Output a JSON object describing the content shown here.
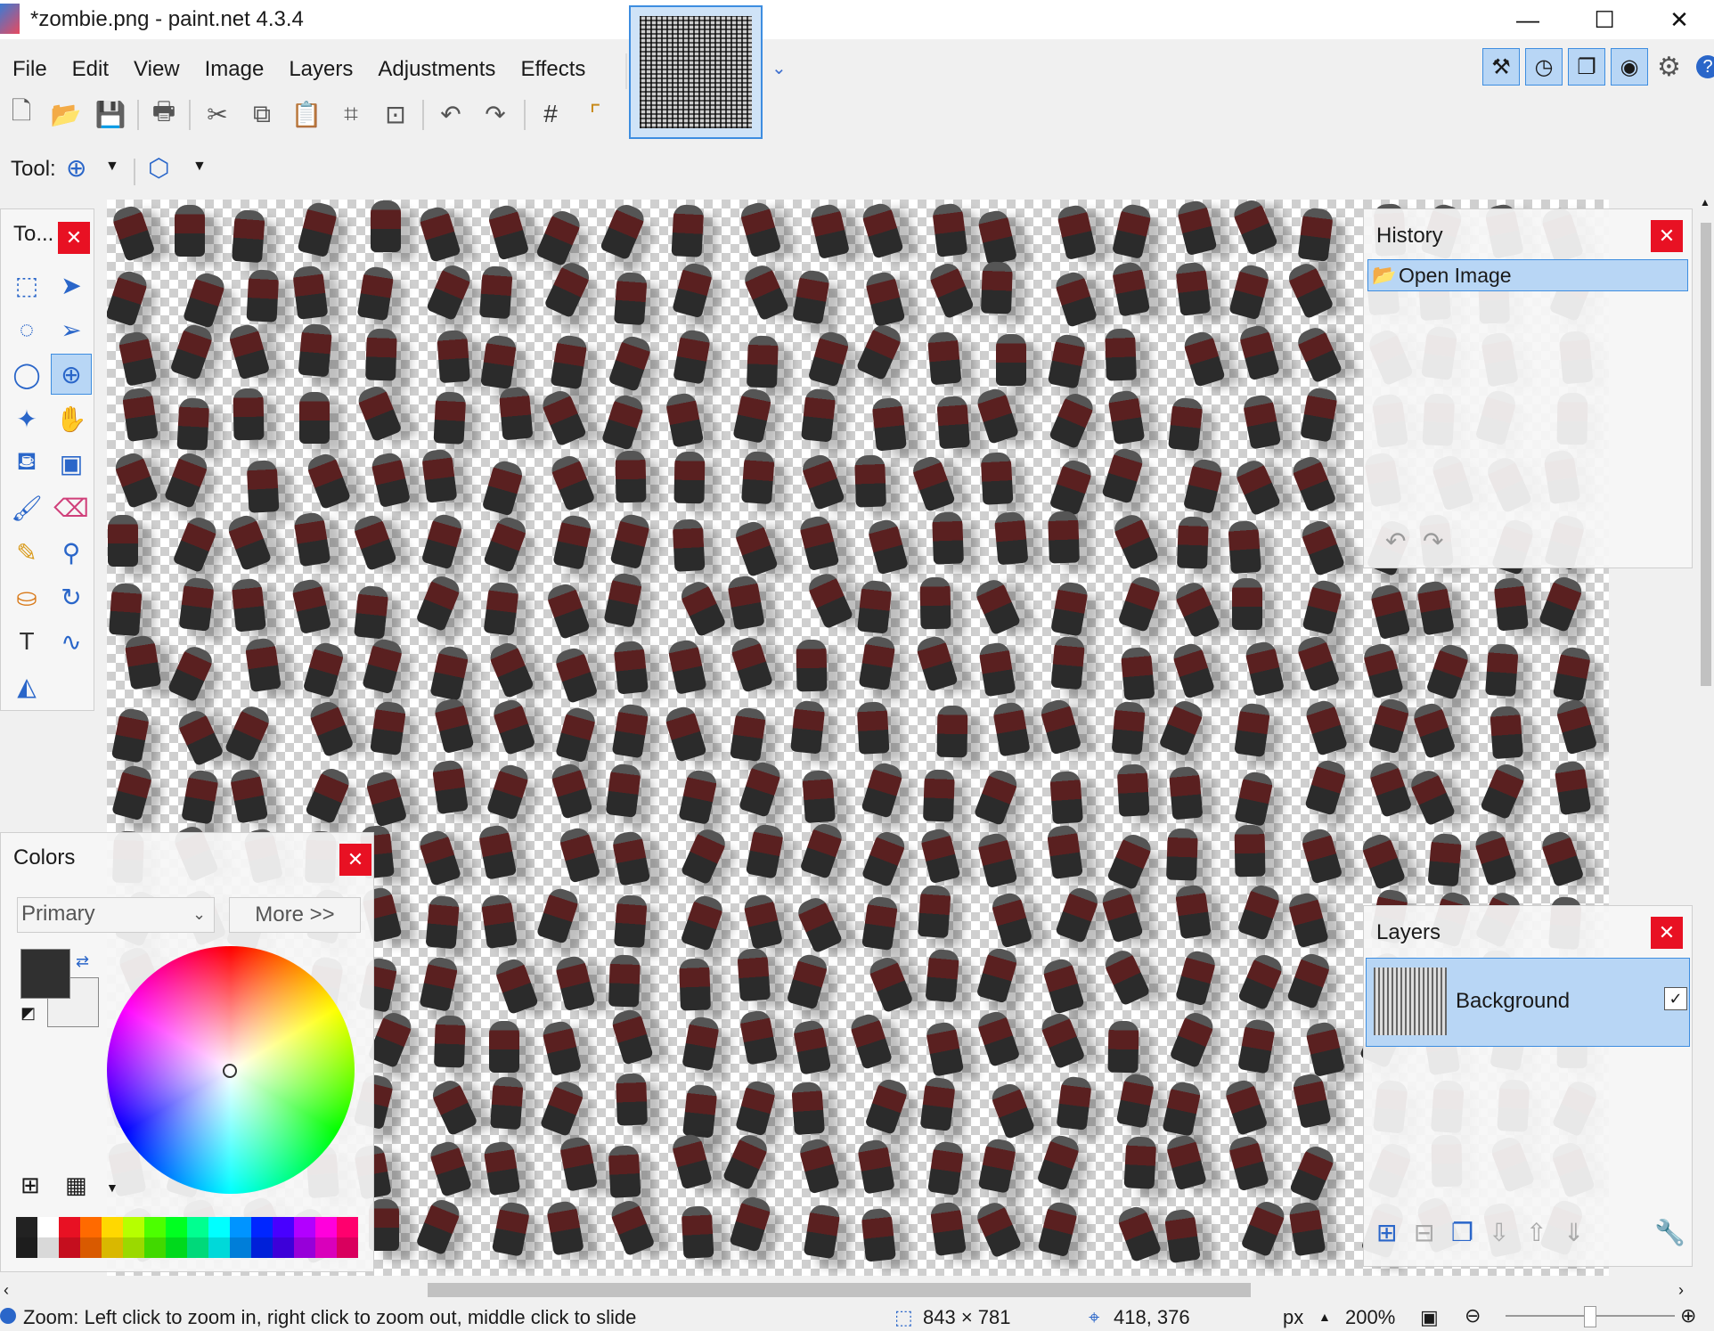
{
  "window": {
    "title": "*zombie.png - paint.net 4.3.4",
    "minimize": "—",
    "maximize": "☐",
    "close": "✕"
  },
  "menu": [
    "File",
    "Edit",
    "View",
    "Image",
    "Layers",
    "Adjustments",
    "Effects"
  ],
  "toolbar": {
    "tool_label": "Tool:"
  },
  "history": {
    "title": "History",
    "items": [
      "Open Image"
    ]
  },
  "layers": {
    "title": "Layers",
    "items": [
      {
        "name": "Background",
        "visible": true
      }
    ]
  },
  "colors": {
    "title": "Colors",
    "mode": "Primary",
    "more_label": "More >>",
    "primary": "#303030",
    "secondary": "#f0f0f0"
  },
  "tools_panel": {
    "title": "To..."
  },
  "status": {
    "hint": "Zoom: Left click to zoom in, right click to zoom out, middle click to slide",
    "size": "843 × 781",
    "cursor": "418, 376",
    "unit": "px",
    "zoom": "200%"
  },
  "palette": [
    "#222222",
    "#ffffff",
    "#e81123",
    "#ff6a00",
    "#ffd800",
    "#b6ff00",
    "#4cff00",
    "#00ff21",
    "#00ff90",
    "#00ffff",
    "#0094ff",
    "#0026ff",
    "#4800ff",
    "#b200ff",
    "#ff00dc",
    "#ff006e"
  ]
}
